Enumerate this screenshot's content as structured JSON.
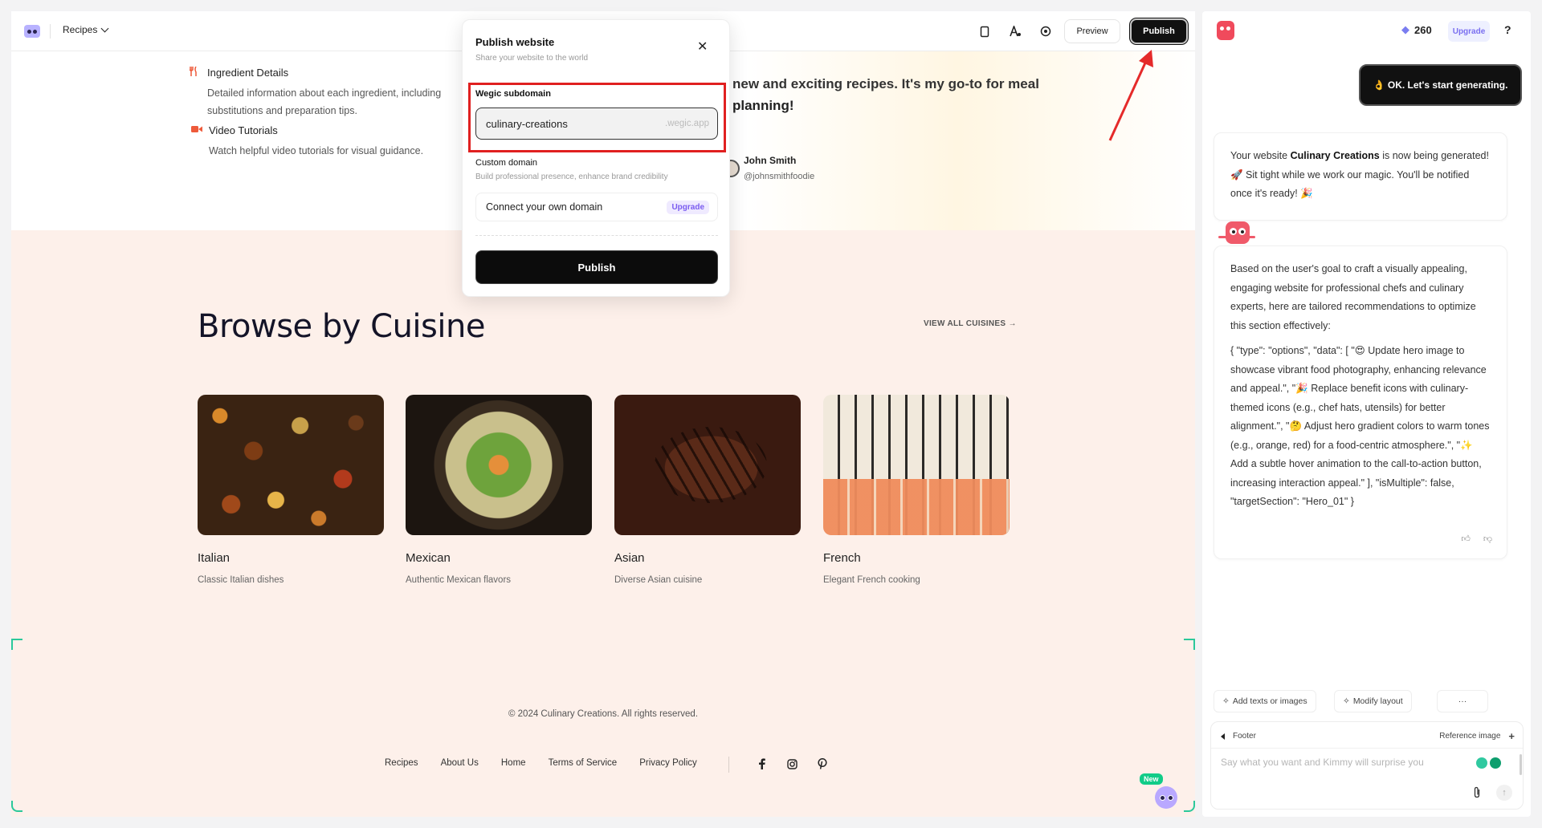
{
  "topbar": {
    "page_selector": "Recipes",
    "preview_label": "Preview",
    "publish_label": "Publish"
  },
  "hero": {
    "features": [
      {
        "title": "Ingredient Details",
        "desc": "Detailed information about each ingredient, including substitutions and preparation tips.",
        "icon": "fork-knife-icon"
      },
      {
        "title": "Video Tutorials",
        "desc": "Watch helpful video tutorials for visual guidance.",
        "icon": "video-icon"
      }
    ],
    "quote_line1": "new and exciting recipes. It's my go-to for meal",
    "quote_line2": "planning!",
    "author_name": "John Smith",
    "author_handle": "@johnsmithfoodie"
  },
  "browse": {
    "title": "Browse by Cuisine",
    "view_all": "VIEW ALL CUISINES",
    "cards": [
      {
        "name": "Italian",
        "desc": "Classic Italian dishes"
      },
      {
        "name": "Mexican",
        "desc": "Authentic Mexican flavors"
      },
      {
        "name": "Asian",
        "desc": "Diverse Asian cuisine"
      },
      {
        "name": "French",
        "desc": "Elegant French cooking"
      }
    ]
  },
  "footer": {
    "copyright": "© 2024 Culinary Creations. All rights reserved.",
    "links": [
      "Recipes",
      "About Us",
      "Home",
      "Terms of Service",
      "Privacy Policy"
    ]
  },
  "fab": {
    "badge": "New"
  },
  "modal": {
    "title": "Publish website",
    "subtitle": "Share your website to the world",
    "subdomain_label": "Wegic subdomain",
    "subdomain_value": "culinary-creations",
    "subdomain_suffix": ".wegic.app",
    "custom_label": "Custom domain",
    "custom_hint": "Build professional presence, enhance brand credibility",
    "connect_domain": "Connect your own domain",
    "upgrade": "Upgrade",
    "publish": "Publish"
  },
  "chat": {
    "credits": "260",
    "upgrade": "Upgrade",
    "help": "?",
    "user_message": "👌 OK. Let's start generating.",
    "status_prefix": "Your website",
    "site_name": "Culinary Creations",
    "status_suffix": "is now being generated! 🚀 Sit tight while we work our magic. You'll be notified once it's ready! 🎉",
    "recommend_intro": "Based on the user's goal to craft a visually appealing, engaging website for professional chefs and culinary experts, here are tailored recommendations to optimize this section effectively:",
    "recommend_json": "{ \"type\": \"options\", \"data\": [ \"😍 Update hero image to showcase vibrant food photography, enhancing relevance and appeal.\", \"🎉 Replace benefit icons with culinary-themed icons (e.g., chef hats, utensils) for better alignment.\", \"🤔 Adjust hero gradient colors to warm tones (e.g., orange, red) for a food-centric atmosphere.\", \"✨ Add a subtle hover animation to the call-to-action button, increasing interaction appeal.\" ], \"isMultiple\": false, \"targetSection\": \"Hero_01\" }",
    "chip_add": "Add texts or images",
    "chip_modify": "Modify layout",
    "chip_more": "···",
    "context_section": "Footer",
    "reference_image": "Reference image",
    "input_placeholder": "Say what you want and Kimmy will surprise you"
  },
  "colors": {
    "accent": "#7a5cf0",
    "highlight_red": "#e02020",
    "section_bg": "#fdf0ea",
    "corner_marker": "#2bc89a"
  }
}
